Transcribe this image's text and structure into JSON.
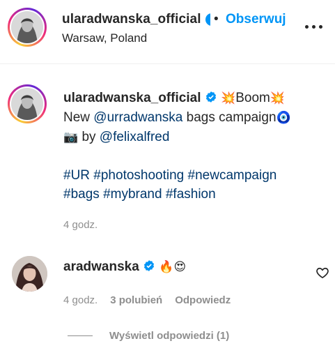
{
  "header": {
    "username": "ularadwanska_official",
    "separator": "•",
    "follow_label": "Obserwuj",
    "location": "Warsaw, Poland",
    "more_icon": "more-horizontal-icon"
  },
  "caption": {
    "username": "ularadwanska_official",
    "verified_icon": "verified-badge-icon",
    "line1_emoji_left": "💥",
    "line1_text": "Boom",
    "line1_emoji_right": "💥",
    "line2_prefix": "New ",
    "line2_mention": "@urradwanska",
    "line2_suffix": " bags campaign",
    "line2_emoji": "🧿",
    "line3_emoji": "📷",
    "line3_by": " by ",
    "line3_mention": "@felixalfred",
    "hashtags_line1": [
      "#UR",
      "#photoshooting",
      "#newcampaign"
    ],
    "hashtags_line2": [
      "#bags",
      "#mybrand",
      "#fashion"
    ],
    "time": "4 godz."
  },
  "comment": {
    "username": "aradwanska",
    "verified_icon": "verified-badge-icon",
    "emojis": "🔥😍",
    "time": "4 godz.",
    "likes": "3 polubień",
    "reply_label": "Odpowiedz",
    "like_icon": "heart-outline-icon"
  },
  "replies": {
    "label": "Wyświetl odpowiedzi (1)"
  },
  "colors": {
    "link": "#00376b",
    "follow": "#0095f6",
    "verified": "#0095f6",
    "muted": "#8e8e8e"
  }
}
